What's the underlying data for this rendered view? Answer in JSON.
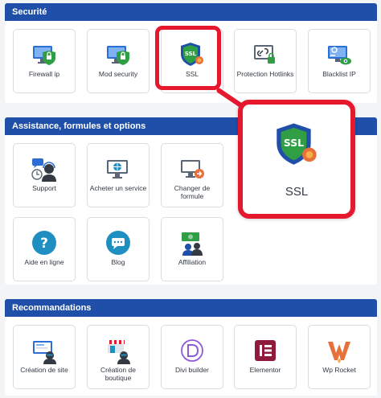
{
  "sections": {
    "security": {
      "title": "Securité",
      "tiles": [
        "Firewall ip",
        "Mod security",
        "SSL",
        "Protection Hotlinks",
        "Blacklist IP"
      ]
    },
    "assistance": {
      "title": "Assistance, formules et options",
      "tiles": [
        "Support",
        "Acheter un service",
        "Changer de formule",
        "Aide en ligne",
        "Blog",
        "Affiliation"
      ]
    },
    "recommendations": {
      "title": "Recommandations",
      "tiles": [
        "Création de site",
        "Création de boutique",
        "Divi builder",
        "Elementor",
        "Wp Rocket"
      ]
    }
  },
  "zoom": {
    "label": "SSL"
  },
  "colors": {
    "header": "#1f4fa8",
    "highlight": "#e5182e",
    "shield": "#2f9e44",
    "accent": "#1f4fa8"
  }
}
